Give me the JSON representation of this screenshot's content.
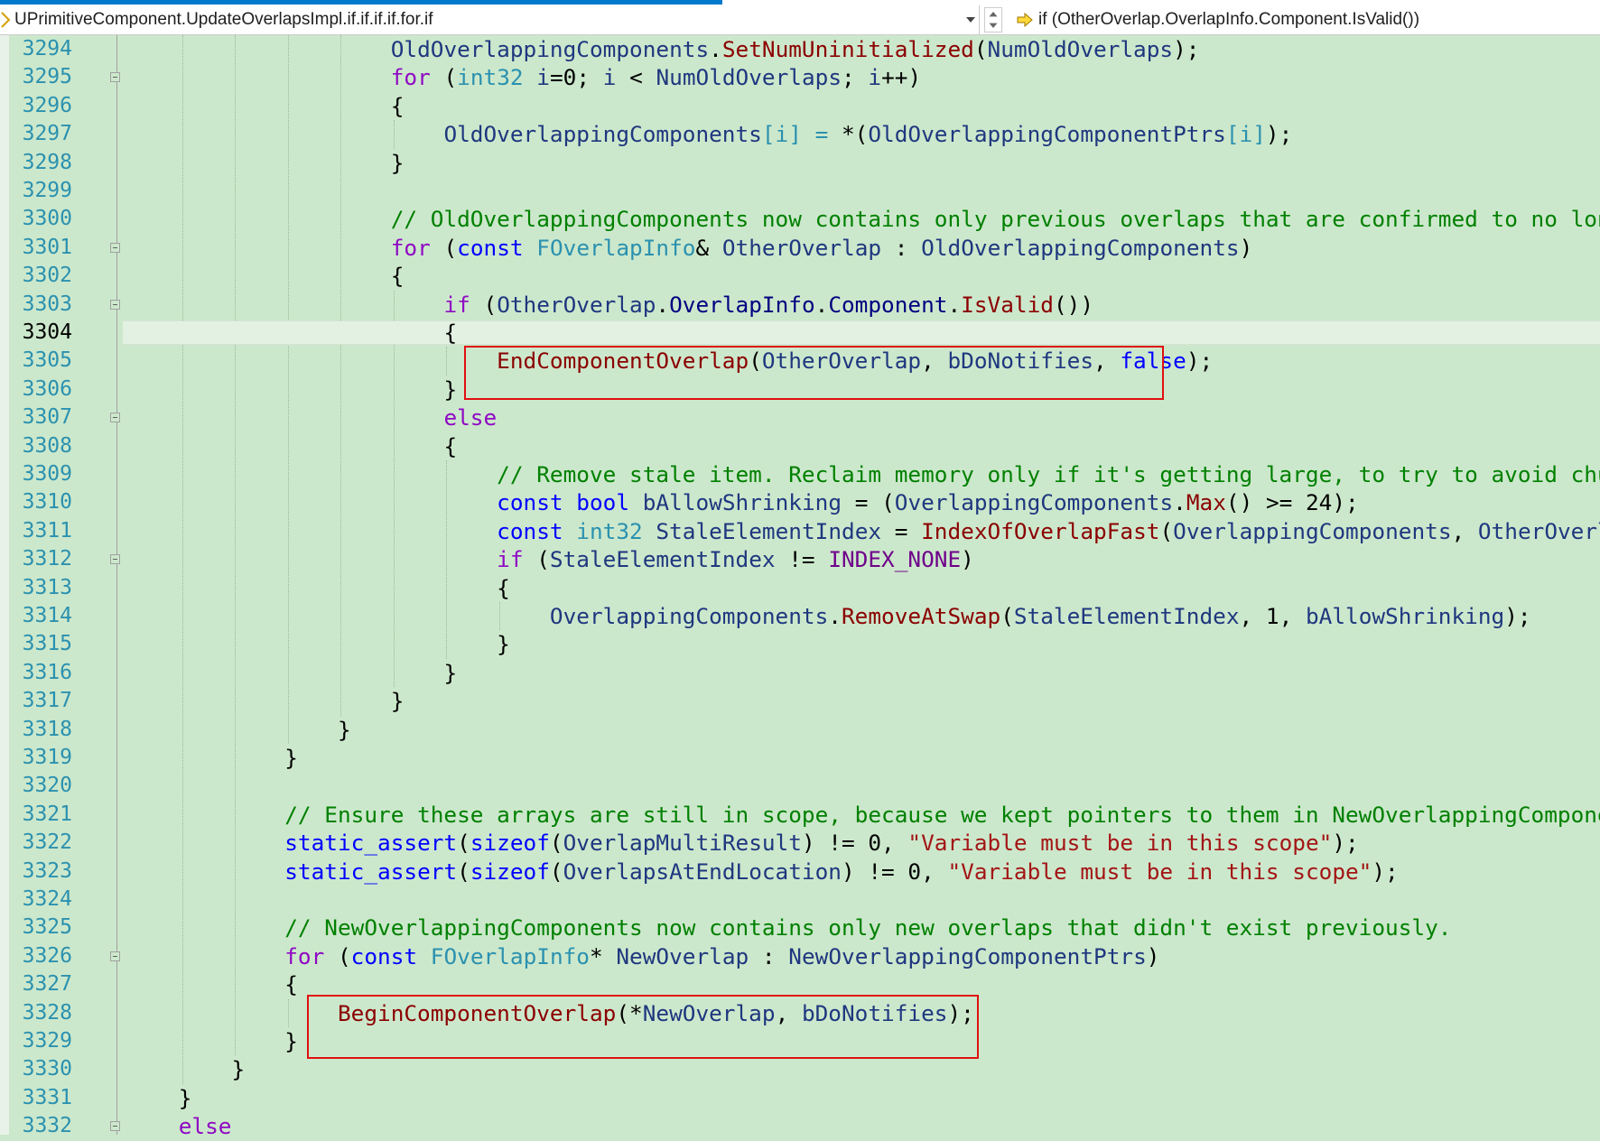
{
  "nav": {
    "scope": "UPrimitiveComponent.UpdateOverlapsImpl.if.if.if.if.for.if",
    "member": "if (OtherOverlap.OverlapInfo.Component.IsValid())"
  },
  "colors": {
    "background": "#cce8cc",
    "line_number": "#2b91af",
    "keyword": "#0000ff",
    "comment": "#008000",
    "string": "#a31515",
    "highlight_box": "#e01010"
  },
  "editor": {
    "current_line": "3304",
    "lines": [
      {
        "num": "3294",
        "fold": false,
        "indent": "                    ",
        "tokens": [
          [
            "id",
            "OldOverlappingComponents"
          ],
          [
            "p",
            "."
          ],
          [
            "fnr",
            "SetNumUninitialized"
          ],
          [
            "p",
            "("
          ],
          [
            "id",
            "NumOldOverlaps"
          ],
          [
            "p",
            ");"
          ]
        ]
      },
      {
        "num": "3295",
        "fold": true,
        "indent": "                    ",
        "tokens": [
          [
            "kwc",
            "for"
          ],
          [
            "p",
            " ("
          ],
          [
            "ty",
            "int32"
          ],
          [
            "p",
            " "
          ],
          [
            "id",
            "i"
          ],
          [
            "p",
            "=0; "
          ],
          [
            "id",
            "i"
          ],
          [
            "p",
            " < "
          ],
          [
            "id",
            "NumOldOverlaps"
          ],
          [
            "p",
            "; "
          ],
          [
            "id",
            "i"
          ],
          [
            "p",
            "++)"
          ]
        ]
      },
      {
        "num": "3296",
        "fold": false,
        "indent": "                    ",
        "tokens": [
          [
            "p",
            "{"
          ]
        ]
      },
      {
        "num": "3297",
        "fold": false,
        "indent": "                        ",
        "tokens": [
          [
            "id",
            "OldOverlappingComponents"
          ],
          [
            "ty",
            "[i]"
          ],
          [
            "p",
            " "
          ],
          [
            "ty",
            "="
          ],
          [
            "p",
            " *("
          ],
          [
            "id",
            "OldOverlappingComponentPtrs"
          ],
          [
            "ty",
            "[i]"
          ],
          [
            "p",
            ");"
          ]
        ]
      },
      {
        "num": "3298",
        "fold": false,
        "indent": "                    ",
        "tokens": [
          [
            "p",
            "}"
          ]
        ]
      },
      {
        "num": "3299",
        "fold": false,
        "indent": "",
        "tokens": []
      },
      {
        "num": "3300",
        "fold": false,
        "indent": "                    ",
        "tokens": [
          [
            "cm",
            "// OldOverlappingComponents now contains only previous overlaps that are confirmed to no longer b"
          ]
        ]
      },
      {
        "num": "3301",
        "fold": true,
        "indent": "                    ",
        "tokens": [
          [
            "kwc",
            "for"
          ],
          [
            "p",
            " ("
          ],
          [
            "kw",
            "const"
          ],
          [
            "p",
            " "
          ],
          [
            "ty",
            "FOverlapInfo"
          ],
          [
            "p",
            "& "
          ],
          [
            "id",
            "OtherOverlap"
          ],
          [
            "p",
            " : "
          ],
          [
            "id",
            "OldOverlappingComponents"
          ],
          [
            "p",
            ")"
          ]
        ]
      },
      {
        "num": "3302",
        "fold": false,
        "indent": "                    ",
        "tokens": [
          [
            "p",
            "{"
          ]
        ]
      },
      {
        "num": "3303",
        "fold": true,
        "indent": "                        ",
        "tokens": [
          [
            "kwc",
            "if"
          ],
          [
            "p",
            " ("
          ],
          [
            "id",
            "OtherOverlap"
          ],
          [
            "p",
            "."
          ],
          [
            "mb",
            "OverlapInfo"
          ],
          [
            "p",
            "."
          ],
          [
            "mb",
            "Component"
          ],
          [
            "p",
            "."
          ],
          [
            "fnr",
            "IsValid"
          ],
          [
            "p",
            "())"
          ]
        ]
      },
      {
        "num": "3304",
        "fold": false,
        "indent": "                        ",
        "tokens": [
          [
            "p",
            "{"
          ]
        ]
      },
      {
        "num": "3305",
        "fold": false,
        "indent": "                            ",
        "tokens": [
          [
            "fnr",
            "EndComponentOverlap"
          ],
          [
            "p",
            "("
          ],
          [
            "id",
            "OtherOverlap"
          ],
          [
            "p",
            ", "
          ],
          [
            "id",
            "bDoNotifies"
          ],
          [
            "p",
            ", "
          ],
          [
            "kw",
            "false"
          ],
          [
            "p",
            ");"
          ]
        ]
      },
      {
        "num": "3306",
        "fold": false,
        "indent": "                        ",
        "tokens": [
          [
            "p",
            "}"
          ]
        ]
      },
      {
        "num": "3307",
        "fold": true,
        "indent": "                        ",
        "tokens": [
          [
            "kwc",
            "else"
          ]
        ]
      },
      {
        "num": "3308",
        "fold": false,
        "indent": "                        ",
        "tokens": [
          [
            "p",
            "{"
          ]
        ]
      },
      {
        "num": "3309",
        "fold": false,
        "indent": "                            ",
        "tokens": [
          [
            "cm",
            "// Remove stale item. Reclaim memory only if it's getting large, to try to avoid churn bu"
          ]
        ]
      },
      {
        "num": "3310",
        "fold": false,
        "indent": "                            ",
        "tokens": [
          [
            "kw",
            "const"
          ],
          [
            "p",
            " "
          ],
          [
            "kw",
            "bool"
          ],
          [
            "p",
            " "
          ],
          [
            "id",
            "bAllowShrinking"
          ],
          [
            "p",
            " = ("
          ],
          [
            "id",
            "OverlappingComponents"
          ],
          [
            "p",
            "."
          ],
          [
            "fnr",
            "Max"
          ],
          [
            "p",
            "() >= 24);"
          ]
        ]
      },
      {
        "num": "3311",
        "fold": false,
        "indent": "                            ",
        "tokens": [
          [
            "kw",
            "const"
          ],
          [
            "p",
            " "
          ],
          [
            "ty",
            "int32"
          ],
          [
            "p",
            " "
          ],
          [
            "id",
            "StaleElementIndex"
          ],
          [
            "p",
            " = "
          ],
          [
            "fnr",
            "IndexOfOverlapFast"
          ],
          [
            "p",
            "("
          ],
          [
            "id",
            "OverlappingComponents"
          ],
          [
            "p",
            ", "
          ],
          [
            "id",
            "OtherOverlap"
          ],
          [
            "p",
            ");"
          ]
        ]
      },
      {
        "num": "3312",
        "fold": true,
        "indent": "                            ",
        "tokens": [
          [
            "kwc",
            "if"
          ],
          [
            "p",
            " ("
          ],
          [
            "id",
            "StaleElementIndex"
          ],
          [
            "p",
            " != "
          ],
          [
            "mc",
            "INDEX_NONE"
          ],
          [
            "p",
            ")"
          ]
        ]
      },
      {
        "num": "3313",
        "fold": false,
        "indent": "                            ",
        "tokens": [
          [
            "p",
            "{"
          ]
        ]
      },
      {
        "num": "3314",
        "fold": false,
        "indent": "                                ",
        "tokens": [
          [
            "id",
            "OverlappingComponents"
          ],
          [
            "p",
            "."
          ],
          [
            "fnr",
            "RemoveAtSwap"
          ],
          [
            "p",
            "("
          ],
          [
            "id",
            "StaleElementIndex"
          ],
          [
            "p",
            ", 1, "
          ],
          [
            "id",
            "bAllowShrinking"
          ],
          [
            "p",
            ");"
          ]
        ]
      },
      {
        "num": "3315",
        "fold": false,
        "indent": "                            ",
        "tokens": [
          [
            "p",
            "}"
          ]
        ]
      },
      {
        "num": "3316",
        "fold": false,
        "indent": "                        ",
        "tokens": [
          [
            "p",
            "}"
          ]
        ]
      },
      {
        "num": "3317",
        "fold": false,
        "indent": "                    ",
        "tokens": [
          [
            "p",
            "}"
          ]
        ]
      },
      {
        "num": "3318",
        "fold": false,
        "indent": "                ",
        "tokens": [
          [
            "p",
            "}"
          ]
        ]
      },
      {
        "num": "3319",
        "fold": false,
        "indent": "            ",
        "tokens": [
          [
            "p",
            "}"
          ]
        ]
      },
      {
        "num": "3320",
        "fold": false,
        "indent": "",
        "tokens": []
      },
      {
        "num": "3321",
        "fold": false,
        "indent": "            ",
        "tokens": [
          [
            "cm",
            "// Ensure these arrays are still in scope, because we kept pointers to them in NewOverlappingComponentPtr"
          ]
        ]
      },
      {
        "num": "3322",
        "fold": false,
        "indent": "            ",
        "tokens": [
          [
            "kw",
            "static_assert"
          ],
          [
            "p",
            "("
          ],
          [
            "kw",
            "sizeof"
          ],
          [
            "p",
            "("
          ],
          [
            "id",
            "OverlapMultiResult"
          ],
          [
            "p",
            ") != 0, "
          ],
          [
            "st",
            "\"Variable must be in this scope\""
          ],
          [
            "p",
            ");"
          ]
        ]
      },
      {
        "num": "3323",
        "fold": false,
        "indent": "            ",
        "tokens": [
          [
            "kw",
            "static_assert"
          ],
          [
            "p",
            "("
          ],
          [
            "kw",
            "sizeof"
          ],
          [
            "p",
            "("
          ],
          [
            "id",
            "OverlapsAtEndLocation"
          ],
          [
            "p",
            ") != 0, "
          ],
          [
            "st",
            "\"Variable must be in this scope\""
          ],
          [
            "p",
            ");"
          ]
        ]
      },
      {
        "num": "3324",
        "fold": false,
        "indent": "",
        "tokens": []
      },
      {
        "num": "3325",
        "fold": false,
        "indent": "            ",
        "tokens": [
          [
            "cm",
            "// NewOverlappingComponents now contains only new overlaps that didn't exist previously."
          ]
        ]
      },
      {
        "num": "3326",
        "fold": true,
        "indent": "            ",
        "tokens": [
          [
            "kwc",
            "for"
          ],
          [
            "p",
            " ("
          ],
          [
            "kw",
            "const"
          ],
          [
            "p",
            " "
          ],
          [
            "ty",
            "FOverlapInfo"
          ],
          [
            "p",
            "* "
          ],
          [
            "id",
            "NewOverlap"
          ],
          [
            "p",
            " : "
          ],
          [
            "id",
            "NewOverlappingComponentPtrs"
          ],
          [
            "p",
            ")"
          ]
        ]
      },
      {
        "num": "3327",
        "fold": false,
        "indent": "            ",
        "tokens": [
          [
            "p",
            "{"
          ]
        ]
      },
      {
        "num": "3328",
        "fold": false,
        "indent": "                ",
        "tokens": [
          [
            "fnr",
            "BeginComponentOverlap"
          ],
          [
            "p",
            "(*"
          ],
          [
            "id",
            "NewOverlap"
          ],
          [
            "p",
            ", "
          ],
          [
            "id",
            "bDoNotifies"
          ],
          [
            "p",
            ");"
          ]
        ]
      },
      {
        "num": "3329",
        "fold": false,
        "indent": "            ",
        "tokens": [
          [
            "p",
            "}"
          ]
        ]
      },
      {
        "num": "3330",
        "fold": false,
        "indent": "        ",
        "tokens": [
          [
            "p",
            "}"
          ]
        ]
      },
      {
        "num": "3331",
        "fold": false,
        "indent": "    ",
        "tokens": [
          [
            "p",
            "}"
          ]
        ]
      },
      {
        "num": "3332",
        "fold": true,
        "indent": "    ",
        "tokens": [
          [
            "kwc",
            "else"
          ]
        ]
      }
    ]
  }
}
